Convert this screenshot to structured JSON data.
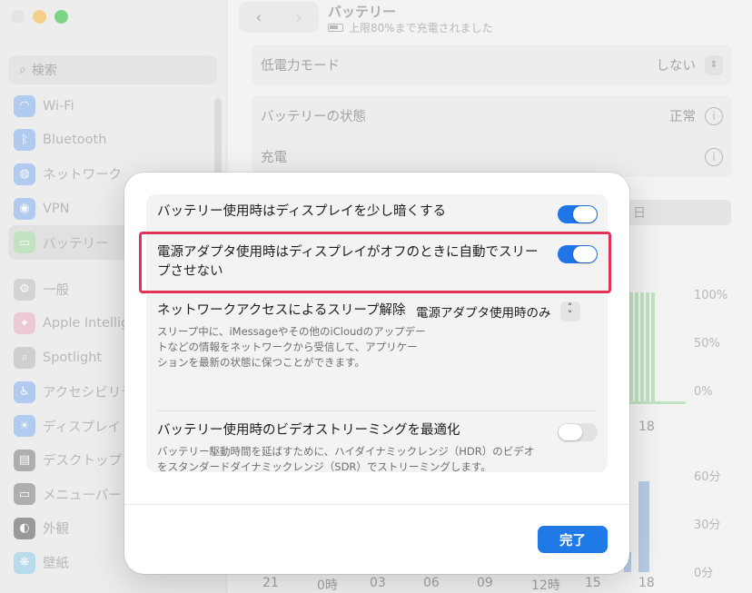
{
  "sidebar": {
    "search_placeholder": "検索",
    "items": [
      {
        "label": "Wi-Fi",
        "icon": "wifi-icon",
        "color": "#4a8ff0"
      },
      {
        "label": "Bluetooth",
        "icon": "bluetooth-icon",
        "color": "#4a8ff0"
      },
      {
        "label": "ネットワーク",
        "icon": "globe-icon",
        "color": "#4a8ff0"
      },
      {
        "label": "VPN",
        "icon": "vpn-icon",
        "color": "#4a8ff0"
      },
      {
        "label": "バッテリー",
        "icon": "battery-icon",
        "color": "#5ac85a"
      },
      {
        "label": "一般",
        "icon": "gear-icon",
        "color": "#9a9a9a"
      },
      {
        "label": "Apple Intellig",
        "icon": "apple-intelligence-icon",
        "color": "#e07aa0"
      },
      {
        "label": "Spotlight",
        "icon": "spotlight-icon",
        "color": "#8a8a8a"
      },
      {
        "label": "アクセシビリテ",
        "icon": "accessibility-icon",
        "color": "#4a8ff0"
      },
      {
        "label": "ディスプレイ",
        "icon": "display-icon",
        "color": "#4a8ff0"
      },
      {
        "label": "デスクトップと",
        "icon": "desktop-icon",
        "color": "#3a3a3a"
      },
      {
        "label": "メニューバー",
        "icon": "menubar-icon",
        "color": "#3a3a3a"
      },
      {
        "label": "外観",
        "icon": "appearance-icon",
        "color": "#3a3a3a"
      },
      {
        "label": "壁紙",
        "icon": "wallpaper-icon",
        "color": "#4ab0e0"
      }
    ]
  },
  "header": {
    "title": "バッテリー",
    "subtitle": "上限80%まで充電されました"
  },
  "settings": {
    "low_power_label": "低電力モード",
    "low_power_value": "しない",
    "battery_health_label": "バッテリーの状態",
    "battery_health_value": "正常",
    "charging_label": "充電",
    "tab_day": "日"
  },
  "chart_axis": {
    "pct": [
      "100%",
      "50%",
      "0%"
    ],
    "minutes": [
      "60分",
      "30分",
      "0分"
    ],
    "x_ticks": [
      "21",
      "0時",
      "03",
      "06",
      "09",
      "12時",
      "15",
      "18"
    ],
    "upper_tick": "18"
  },
  "modal": {
    "dim_display_label": "バッテリー使用時はディスプレイを少し暗くする",
    "dim_display_on": true,
    "prevent_sleep_label": "電源アダプタ使用時はディスプレイがオフのときに自動でスリープさせない",
    "prevent_sleep_on": true,
    "network_wake_label": "ネットワークアクセスによるスリープ解除",
    "network_wake_value": "電源アダプタ使用時のみ",
    "network_wake_desc": "スリープ中に、iMessageやその他のiCloudのアップデートなどの情報をネットワークから受信して、アプリケーションを最新の状態に保つことができます。",
    "video_label": "バッテリー使用時のビデオストリーミングを最適化",
    "video_on": false,
    "video_desc": "バッテリー駆動時間を延ばすために、ハイダイナミックレンジ（HDR）のビデオをスタンダードダイナミックレンジ（SDR）でストリーミングします。",
    "done_label": "完了",
    "accent": "#1f74e8",
    "highlight_color": "#e03359"
  }
}
